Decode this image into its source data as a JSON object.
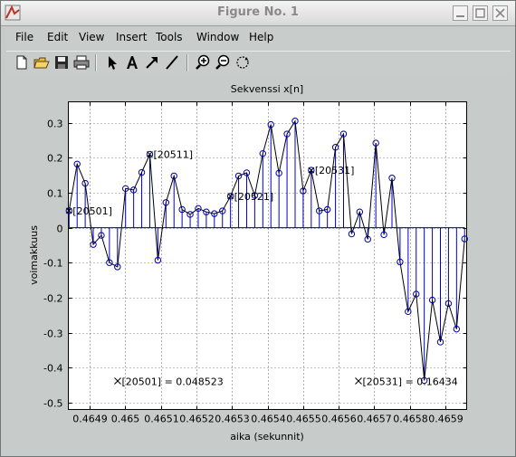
{
  "window": {
    "title": "Figure No. 1"
  },
  "menu": [
    "File",
    "Edit",
    "View",
    "Insert",
    "Tools",
    "Window",
    "Help"
  ],
  "toolbar": [
    "new-figure",
    "open-file",
    "save",
    "print",
    "select-arrow",
    "insert-text",
    "insert-arrow",
    "insert-line",
    "zoom-in",
    "zoom-out",
    "rotate-3d"
  ],
  "chart_data": {
    "type": "stem",
    "title": "Sekvenssi x[n]",
    "xlabel": "aika (sekunnit)",
    "ylabel": "voimakkuus",
    "xlim": [
      0.46484,
      0.46596
    ],
    "ylim": [
      -0.52,
      0.36
    ],
    "x_ticks": [
      0.4649,
      0.465,
      0.4651,
      0.4652,
      0.4653,
      0.4654,
      0.4655,
      0.4656,
      0.4657,
      0.4658,
      0.4659
    ],
    "x_tick_labels": [
      "0.4649",
      "0.465",
      "0.4651",
      "0.4652",
      "0.4653",
      "0.4654",
      "0.4655",
      "0.4656",
      "0.4657",
      "0.4658",
      "0.4659"
    ],
    "y_ticks": [
      -0.5,
      -0.4,
      -0.3,
      -0.2,
      -0.1,
      0,
      0.1,
      0.2,
      0.3
    ],
    "y_tick_labels": [
      "-0.5",
      "-0.4",
      "-0.3",
      "-0.2",
      "-0.1",
      "0",
      "0.1",
      "0.2",
      "0.3"
    ],
    "grid": true,
    "line_color": "#000000",
    "stem_color": "#0000cc",
    "marker_color": "#0000aa",
    "x_start": 0.464842,
    "x_step": 2.27e-05,
    "values": [
      0.048523,
      0.182,
      0.127,
      -0.048,
      -0.022,
      -0.1,
      -0.112,
      0.112,
      0.108,
      0.158,
      0.21,
      -0.093,
      0.072,
      0.148,
      0.052,
      0.038,
      0.055,
      0.045,
      0.04,
      0.048,
      0.09,
      0.148,
      0.157,
      0.092,
      0.212,
      0.295,
      0.156,
      0.268,
      0.305,
      0.105,
      0.16434,
      0.048,
      0.052,
      0.23,
      0.268,
      -0.018,
      0.045,
      -0.033,
      0.242,
      -0.02,
      0.142,
      -0.098,
      -0.24,
      -0.19,
      -0.437,
      -0.207,
      -0.327,
      -0.217,
      -0.29,
      -0.032
    ],
    "annotations": [
      {
        "text": "[20501]",
        "point": 0
      },
      {
        "text": "[20511]",
        "point": 10
      },
      {
        "text": "[20521]",
        "point": 20
      },
      {
        "text": "[20531]",
        "point": 30
      }
    ],
    "datatips": [
      {
        "text": "[20501] = 0.048523"
      },
      {
        "text": "[20531] = 0.16434"
      }
    ]
  }
}
